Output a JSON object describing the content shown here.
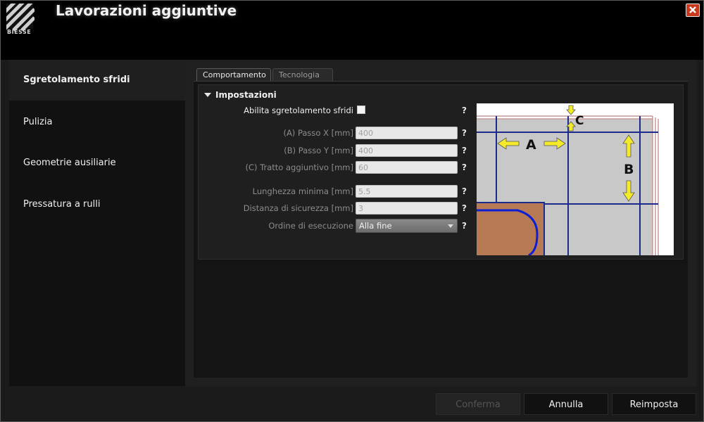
{
  "window": {
    "title": "Lavorazioni aggiuntive",
    "logo_text": "BIESSE",
    "close_icon": "close-icon"
  },
  "sidebar": {
    "items": [
      {
        "label": "Sgretolamento sfridi",
        "active": true
      },
      {
        "label": "Pulizia",
        "active": false
      },
      {
        "label": "Geometrie ausiliarie",
        "active": false
      },
      {
        "label": "Pressatura a rulli",
        "active": false
      }
    ]
  },
  "tabs": [
    {
      "label": "Comportamento",
      "active": true
    },
    {
      "label": "Tecnologia",
      "active": false
    }
  ],
  "settings": {
    "section_title": "Impostazioni",
    "enable_label": "Abilita sgretolamento sfridi",
    "enable_checked": false,
    "help": "?",
    "fields": [
      {
        "label": "(A) Passo X [mm]",
        "value": "400"
      },
      {
        "label": "(B) Passo Y [mm]",
        "value": "400"
      },
      {
        "label": "(C) Tratto aggiuntivo [mm]",
        "value": "60"
      },
      {
        "label": "Lunghezza minima [mm]",
        "value": "5.5"
      },
      {
        "label": "Distanza di sicurezza [mm]",
        "value": "3"
      }
    ],
    "order": {
      "label": "Ordine di esecuzione",
      "value": "Alla fine"
    }
  },
  "diagram": {
    "labels": {
      "a": "A",
      "b": "B",
      "c": "C"
    },
    "colors": {
      "background": "#c8c8c8",
      "grid_line": "#1c2a8c",
      "arrow": "#f5ea2a",
      "piece": "#b87a55",
      "piece_outline": "#0a1fd6",
      "border": "#c89a9a"
    }
  },
  "buttons": {
    "confirm": "Conferma",
    "cancel": "Annulla",
    "reset": "Reimposta"
  }
}
